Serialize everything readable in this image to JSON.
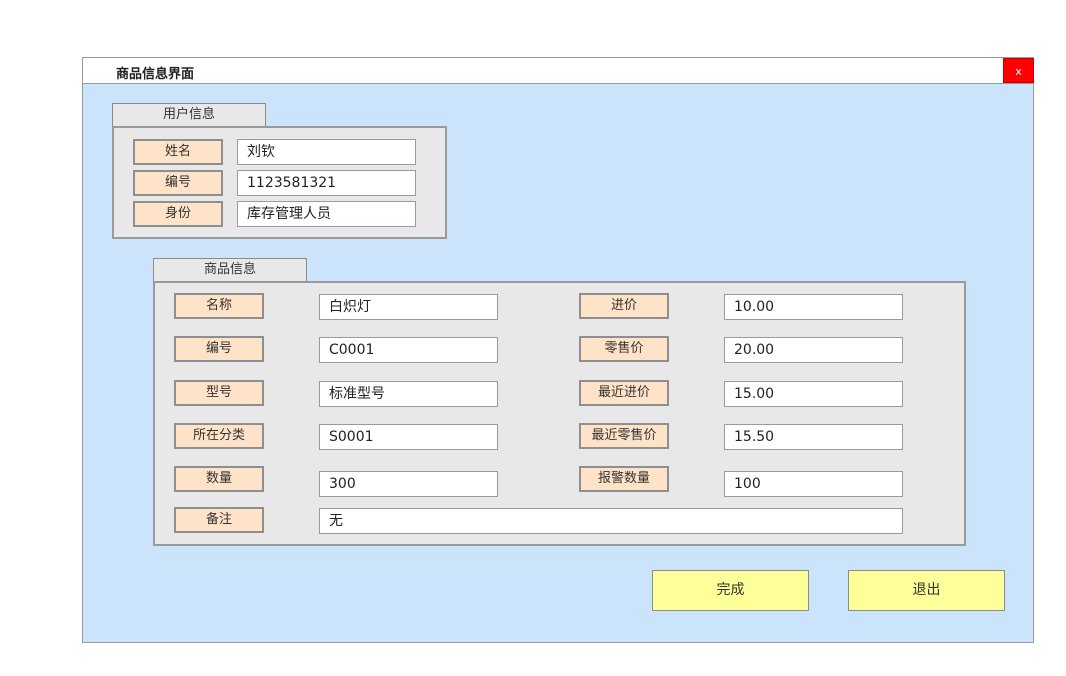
{
  "window": {
    "title": "商品信息界面",
    "close_label": "x"
  },
  "user_info": {
    "tab_label": "用户信息",
    "rows": [
      {
        "label": "姓名",
        "value": "刘钦"
      },
      {
        "label": "编号",
        "value": "1123581321"
      },
      {
        "label": "身份",
        "value": "库存管理人员"
      }
    ]
  },
  "product_info": {
    "tab_label": "商品信息",
    "left": [
      {
        "label": "名称",
        "value": "白炽灯"
      },
      {
        "label": "编号",
        "value": "C0001"
      },
      {
        "label": "型号",
        "value": "标准型号"
      },
      {
        "label": "所在分类",
        "value": "S0001"
      },
      {
        "label": "数量",
        "value": "300"
      }
    ],
    "right": [
      {
        "label": "进价",
        "value": "10.00"
      },
      {
        "label": "零售价",
        "value": "20.00"
      },
      {
        "label": "最近进价",
        "value": "15.00"
      },
      {
        "label": "最近零售价",
        "value": "15.50"
      },
      {
        "label": "报警数量",
        "value": "100"
      }
    ],
    "note": {
      "label": "备注",
      "value": "无"
    }
  },
  "actions": {
    "done_label": "完成",
    "exit_label": "退出"
  },
  "colors": {
    "background": "#cce4fb",
    "label_fill": "#fee3c9",
    "button_fill": "#ffff99",
    "close_fill": "#ff0000"
  }
}
